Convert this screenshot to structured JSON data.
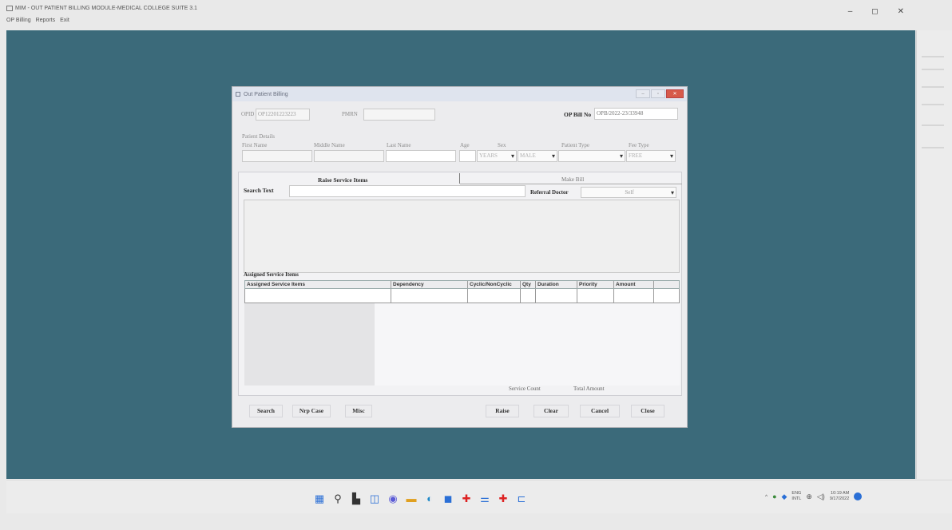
{
  "app": {
    "title": "MIM - OUT PATIENT BILLING MODULE-MEDICAL COLLEGE SUITE 3.1",
    "menu": [
      "OP Billing",
      "Reports",
      "Exit"
    ],
    "minimize": "–",
    "maximize": "◻",
    "close": "✕"
  },
  "dialog": {
    "title": "Out Patient Billing",
    "btn_min": "–",
    "btn_max": "▫",
    "btn_close": "✕",
    "opid_label": "OPID",
    "opid_value": "OP12201223223",
    "pmrn_label": "PMRN",
    "pmrn_value": "",
    "opbill_label": "OP Bill No",
    "opbill_value": "OPB/2022-23/33948",
    "patient_details": "Patient Details",
    "first_name": "First Name",
    "middle_name": "Middle Name",
    "last_name": "Last Name",
    "age": "Age",
    "sex": "Sex",
    "patient_type": "Patient Type",
    "fee_type": "Fee Type",
    "age_unit": "YEARS",
    "sex_value": "MALE",
    "fee_value": "FREE",
    "tab_raise": "Raise Service Items",
    "tab_make": "Make Bill",
    "search_text": "Search Text",
    "referral_doctor": "Referral Doctor",
    "referral_value": "Self",
    "assigned_title": "Assigned Service Items",
    "columns": [
      "Assigned Service Items",
      "Dependency",
      "Cyclic/NonCyclic",
      "Qty",
      "Duration",
      "Priority",
      "Amount"
    ],
    "service_count": "Service Count",
    "total_amount": "Total Amount",
    "buttons": {
      "search": "Search",
      "nrp_case": "Nrp Case",
      "misc": "Misc",
      "raise": "Raise",
      "clear": "Clear",
      "cancel": "Cancel",
      "close": "Close"
    }
  },
  "tray": {
    "lang": "ENG",
    "region": "INTL",
    "time": "10:19 AM",
    "date": "9/17/2022"
  },
  "colors": {
    "desktop": "#3b6a7a",
    "close_btn": "#d75a4a"
  }
}
